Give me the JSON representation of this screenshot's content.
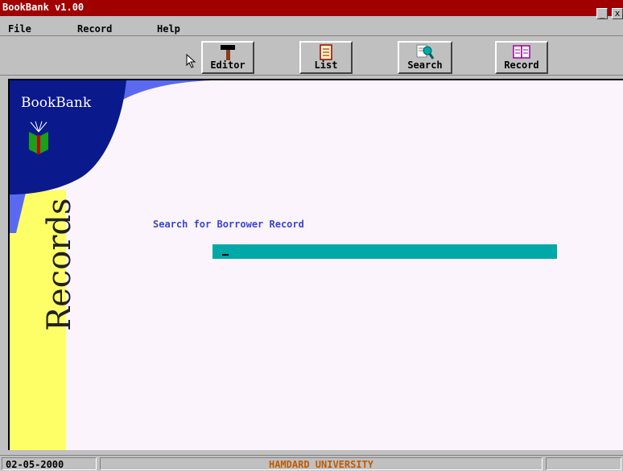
{
  "window": {
    "title": "BookBank v1.00",
    "minimize_label": "_",
    "close_label": "x"
  },
  "menu": [
    {
      "label": "File"
    },
    {
      "label": "Record"
    },
    {
      "label": "Help"
    }
  ],
  "toolbar": {
    "buttons": [
      {
        "label": "Editor",
        "icon": "hammer-icon"
      },
      {
        "label": "List",
        "icon": "list-icon"
      },
      {
        "label": "Search",
        "icon": "magnifier-icon"
      },
      {
        "label": "Record",
        "icon": "open-book-icon"
      }
    ]
  },
  "main": {
    "brand": "BookBank",
    "side_label": "Records",
    "prompt": "Search for Borrower Record",
    "search_value": ""
  },
  "status": {
    "date": "02-05-2000",
    "center": "HAMDARD UNIVERSITY"
  },
  "colors": {
    "title_bar": "#a00000",
    "panel_bg": "#fcf4fc",
    "logo_blue": "#0a1a8c",
    "side_yellow": "#fefe66",
    "input_teal": "#00a8a8",
    "prompt_text": "#3a44d8",
    "status_text": "#c05a00"
  }
}
